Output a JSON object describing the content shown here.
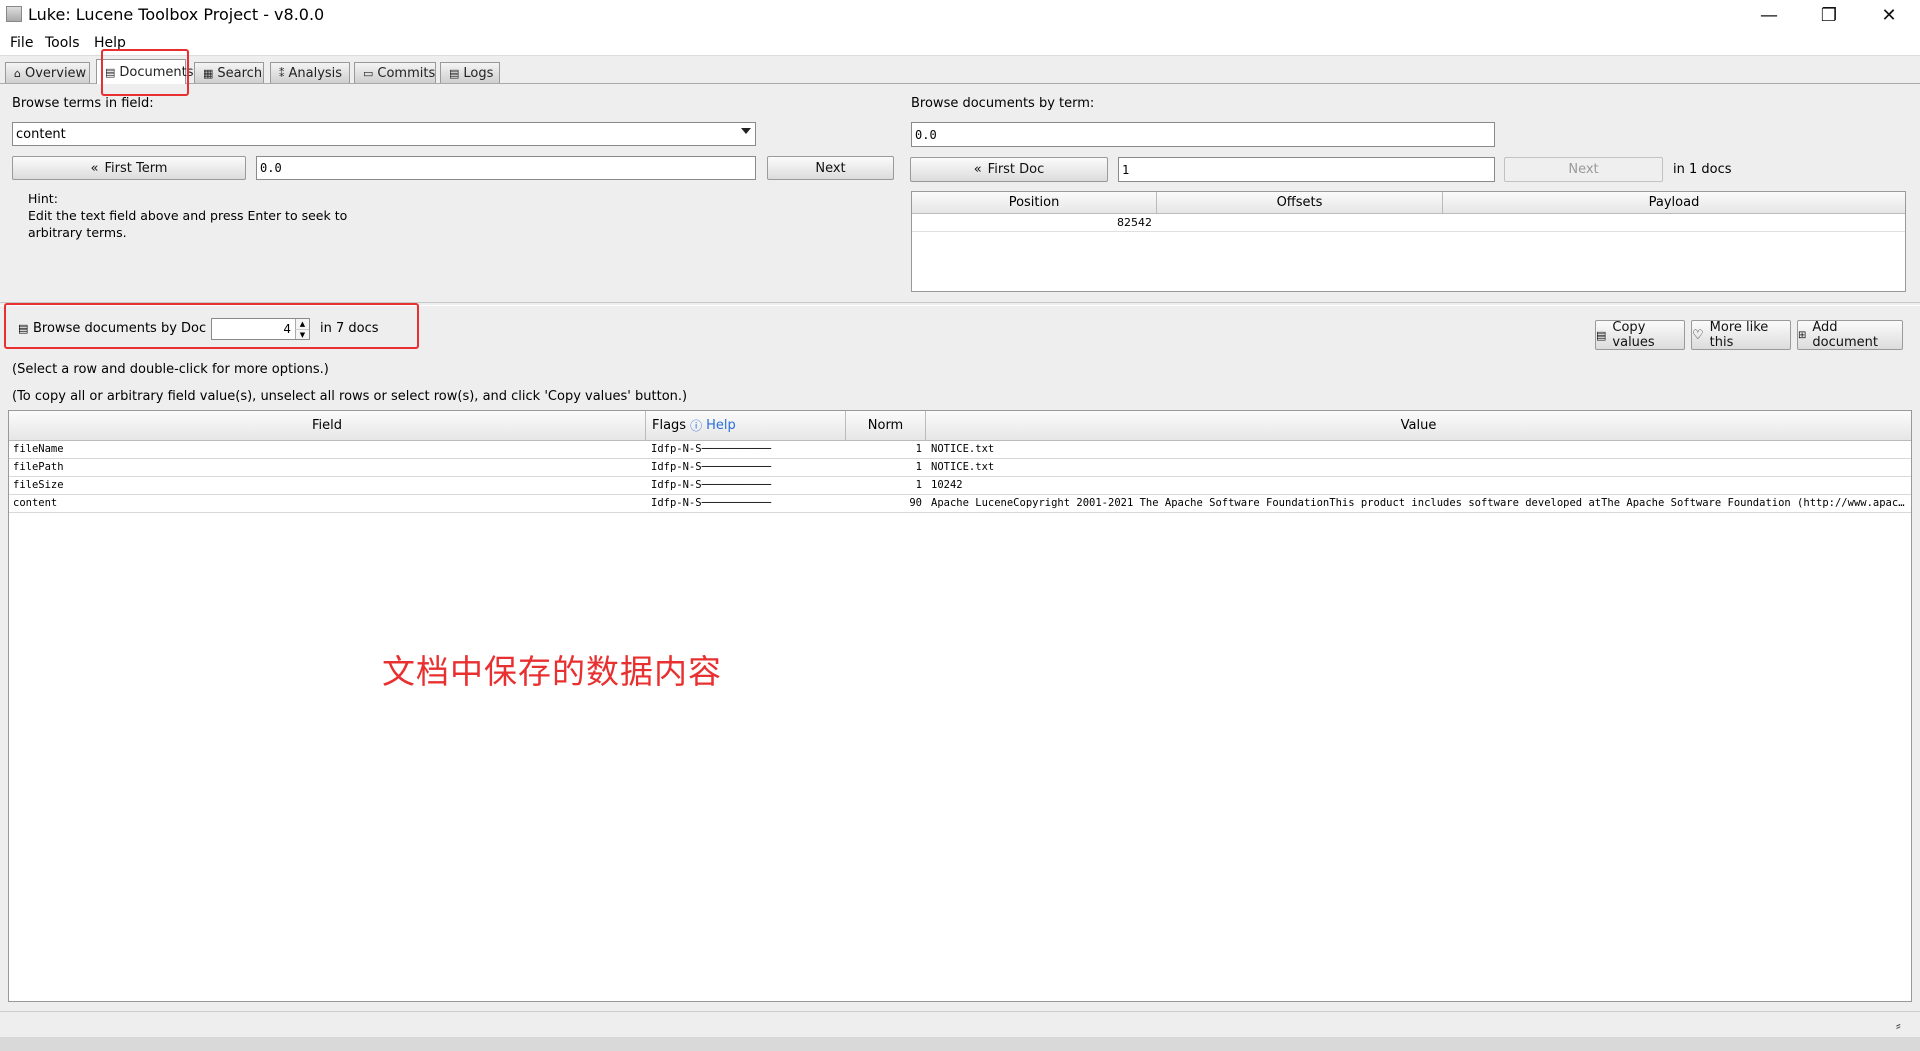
{
  "window": {
    "title": "Luke: Lucene Toolbox Project - v8.0.0",
    "controls": {
      "minimize": "—",
      "maximize": "❐",
      "close": "✕"
    }
  },
  "menu": [
    "File",
    "Tools",
    "Help"
  ],
  "tabs": [
    {
      "label": "Overview",
      "icon": "home-icon",
      "glyph": "⌂"
    },
    {
      "label": "Documents",
      "icon": "document-icon",
      "glyph": "▤",
      "active": true
    },
    {
      "label": "Search",
      "icon": "search-icon",
      "glyph": "▦"
    },
    {
      "label": "Analysis",
      "icon": "analysis-icon",
      "glyph": "⁑"
    },
    {
      "label": "Commits",
      "icon": "commits-icon",
      "glyph": "▭"
    },
    {
      "label": "Logs",
      "icon": "logs-icon",
      "glyph": "▤"
    }
  ],
  "terms": {
    "label": "Browse terms in field:",
    "field_value": "content",
    "first_term_label": "First Term",
    "term_value": "0.0",
    "next_label": "Next",
    "hint_title": "Hint:",
    "hint_line1": "Edit the text field above and press Enter to seek to",
    "hint_line2": "arbitrary terms."
  },
  "docs_by_term": {
    "label": "Browse documents by term:",
    "term_value": "0.0",
    "first_doc_label": "First Doc",
    "doc_value": "1",
    "next_label": "Next",
    "count_text": "in 1 docs",
    "columns": [
      "Position",
      "Offsets",
      "Payload"
    ],
    "rows": [
      {
        "position": "82542",
        "offsets": "",
        "payload": ""
      }
    ]
  },
  "doc_browser": {
    "label": "Browse documents by Doc #",
    "doc_number": "4",
    "count_text": "in 7 docs",
    "copy_values_label": "Copy values",
    "more_like_this_label": "More like this",
    "add_document_label": "Add document",
    "instruction1": "(Select a row and double-click for more options.)",
    "instruction2": "(To copy all or arbitrary field value(s), unselect all rows or select row(s), and click 'Copy values' button.)"
  },
  "fields_table": {
    "columns": {
      "field": "Field",
      "flags": "Flags",
      "help": "Help",
      "norm": "Norm",
      "value": "Value"
    },
    "rows": [
      {
        "field": "fileName",
        "flags": "Idfp-N-S───────────",
        "norm": "1",
        "value": "NOTICE.txt"
      },
      {
        "field": "filePath",
        "flags": "Idfp-N-S───────────",
        "norm": "1",
        "value": "NOTICE.txt"
      },
      {
        "field": "fileSize",
        "flags": "Idfp-N-S───────────",
        "norm": "1",
        "value": "10242"
      },
      {
        "field": "content",
        "flags": "Idfp-N-S───────────",
        "norm": "90",
        "value": "Apache LuceneCopyright 2001-2021 The Apache Software FoundationThis product includes software developed atThe Apache Software Foundation (http://www.apache.org..."
      }
    ]
  },
  "annotation": {
    "text": "文档中保存的数据内容",
    "color": "#e83030"
  }
}
